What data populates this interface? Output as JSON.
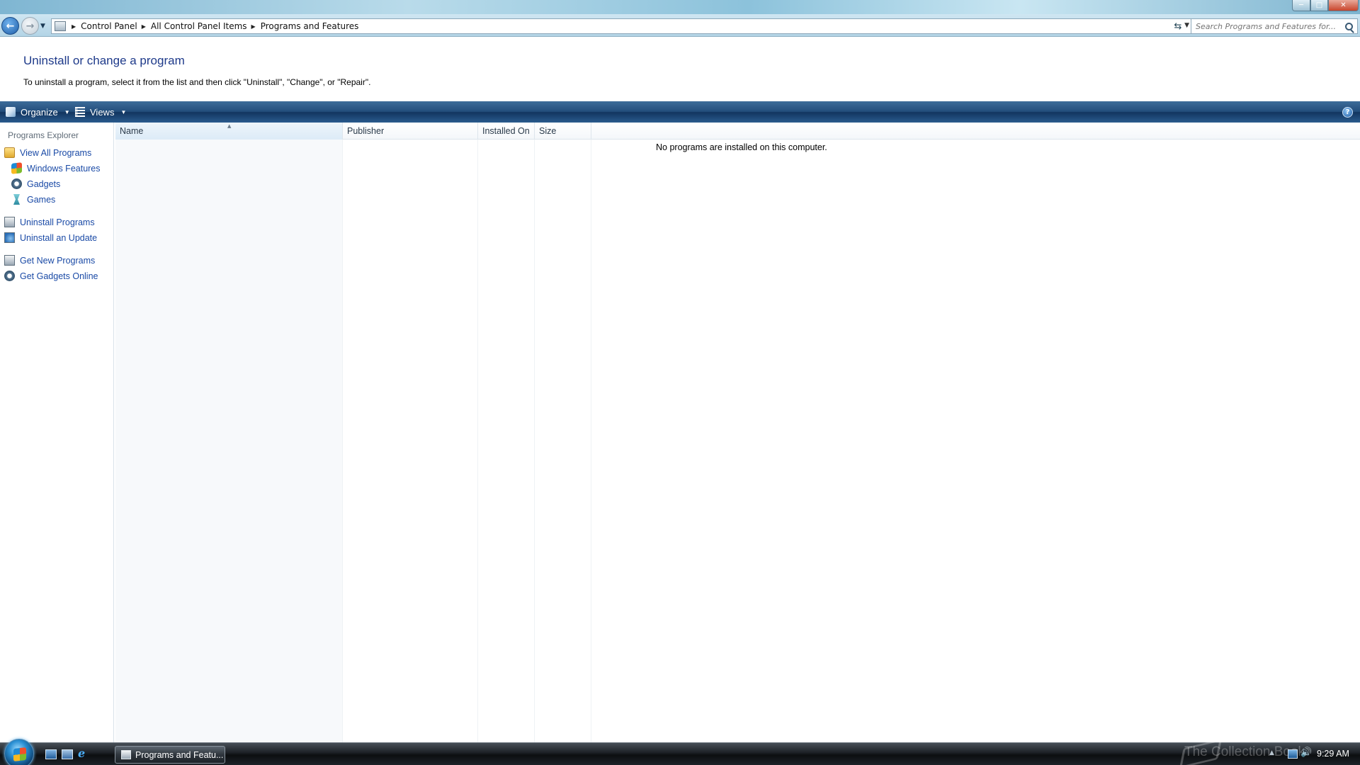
{
  "window": {
    "min_label": "─",
    "max_label": "□",
    "close_label": "✕"
  },
  "navigation": {
    "back_label": "←",
    "forward_label": "→",
    "breadcrumbs": [
      "Control Panel",
      "All Control Panel Items",
      "Programs and Features"
    ],
    "search_placeholder": "Search Programs and Features for..."
  },
  "header": {
    "title": "Uninstall or change a program",
    "description": "To uninstall a program, select it from the list and then click \"Uninstall\", \"Change\", or \"Repair\"."
  },
  "toolbar": {
    "organize_label": "Organize",
    "views_label": "Views",
    "help_label": "?"
  },
  "sidebar": {
    "heading": "Programs Explorer",
    "items": [
      {
        "label": "View All Programs",
        "icon": "folder-icon"
      },
      {
        "label": "Windows Features",
        "icon": "windows-flag-icon"
      },
      {
        "label": "Gadgets",
        "icon": "gadget-icon"
      },
      {
        "label": "Games",
        "icon": "games-icon"
      },
      {
        "label": "Uninstall Programs",
        "icon": "control-panel-icon"
      },
      {
        "label": "Uninstall an Update",
        "icon": "update-icon"
      },
      {
        "label": "Get New Programs",
        "icon": "control-panel-icon"
      },
      {
        "label": "Get Gadgets Online",
        "icon": "gadget-icon"
      }
    ]
  },
  "list": {
    "columns": [
      "Name",
      "Publisher",
      "Installed On",
      "Size"
    ],
    "empty_message": "No programs are installed on this computer."
  },
  "taskbar": {
    "task_label": "Programs and Featu...",
    "watermark": "The Collection Book",
    "clock": "9:29 AM"
  },
  "colors": {
    "link": "#1a4aa6",
    "title": "#1e3a8a",
    "toolbar": "#234e7c",
    "taskbar": "#1b1f24"
  }
}
